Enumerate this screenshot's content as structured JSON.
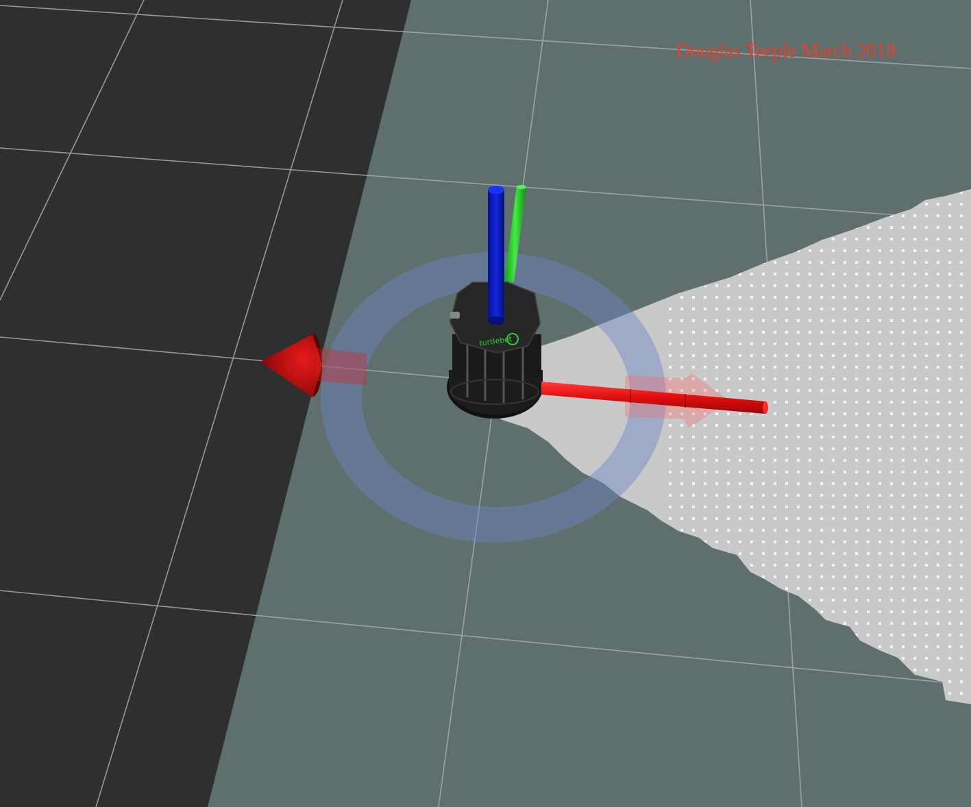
{
  "viewer": {
    "watermark": "Douglas Teeple March 2018",
    "robot_logo_text": "turtlebot"
  },
  "colors": {
    "background": "#2f2f2f",
    "map_free_space": "#5f6f6d",
    "grid_line": "#a8acad",
    "laser_cone": "#c9c9c9",
    "laser_point": "#f4f4f4",
    "axis_x": "#e01010",
    "axis_y": "#2ed02e",
    "axis_z": "#0a18c8",
    "ring": "#6c86c4",
    "robot_body": "#1e1e1e",
    "watermark": "#e4412d"
  },
  "icons": {
    "interactive_marker": "rotation-ring-icon",
    "move_arrow": "arrow-cone-icon"
  }
}
